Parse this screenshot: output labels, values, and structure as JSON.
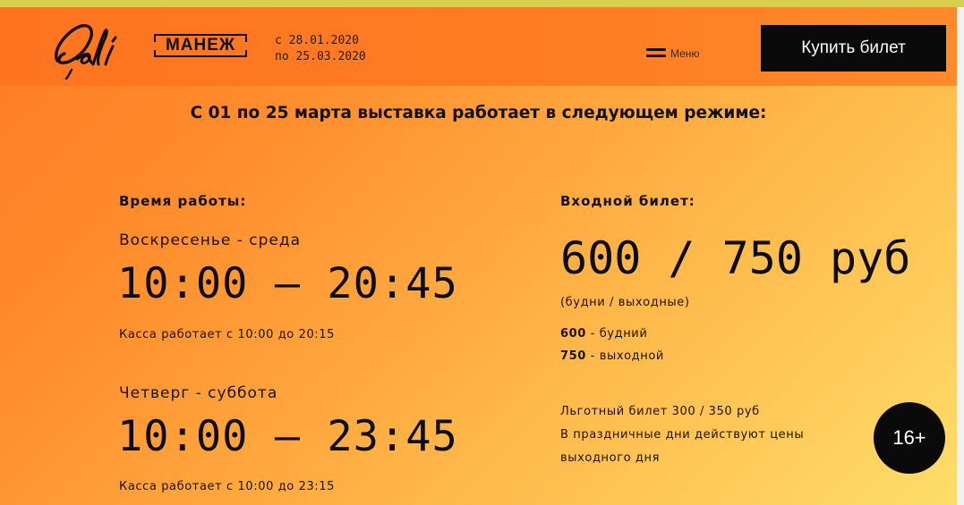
{
  "header": {
    "dali_logo_text": "Dali",
    "manezh_logo_text": "МАНЕЖ",
    "date_from": "с 28.01.2020",
    "date_to": "по 25.03.2020",
    "menu_label": "Меню",
    "buy_button_label": "Купить билет"
  },
  "notice": "С 01 по 25 марта выставка работает в следующем режиме:",
  "hours": {
    "title": "Время работы:",
    "blocks": [
      {
        "days": "Воскресенье - среда",
        "time": "10:00 – 20:45",
        "box_office": "Касса работает с 10:00 до 20:15"
      },
      {
        "days": "Четверг - суббота",
        "time": "10:00 – 23:45",
        "box_office": "Касса работает с 10:00 до 23:15"
      }
    ]
  },
  "ticket": {
    "title": "Входной билет:",
    "price": "600 / 750 руб",
    "note": "(будни / выходные)",
    "rows": [
      {
        "value": "600",
        "label": " - будний"
      },
      {
        "value": "750",
        "label": " - выходной"
      }
    ],
    "discount": "Льготный билет 300 / 350 руб",
    "holiday_line1": "В праздничные дни действуют цены",
    "holiday_line2": "выходного дня"
  },
  "age_rating": "16+",
  "colors": {
    "accent_orange": "#ff7a24",
    "accent_yellow": "#fedd6a",
    "button_bg": "#0a0a0a",
    "top_strip": "#d6cf4f"
  },
  "icons": {
    "menu": "hamburger-icon"
  }
}
